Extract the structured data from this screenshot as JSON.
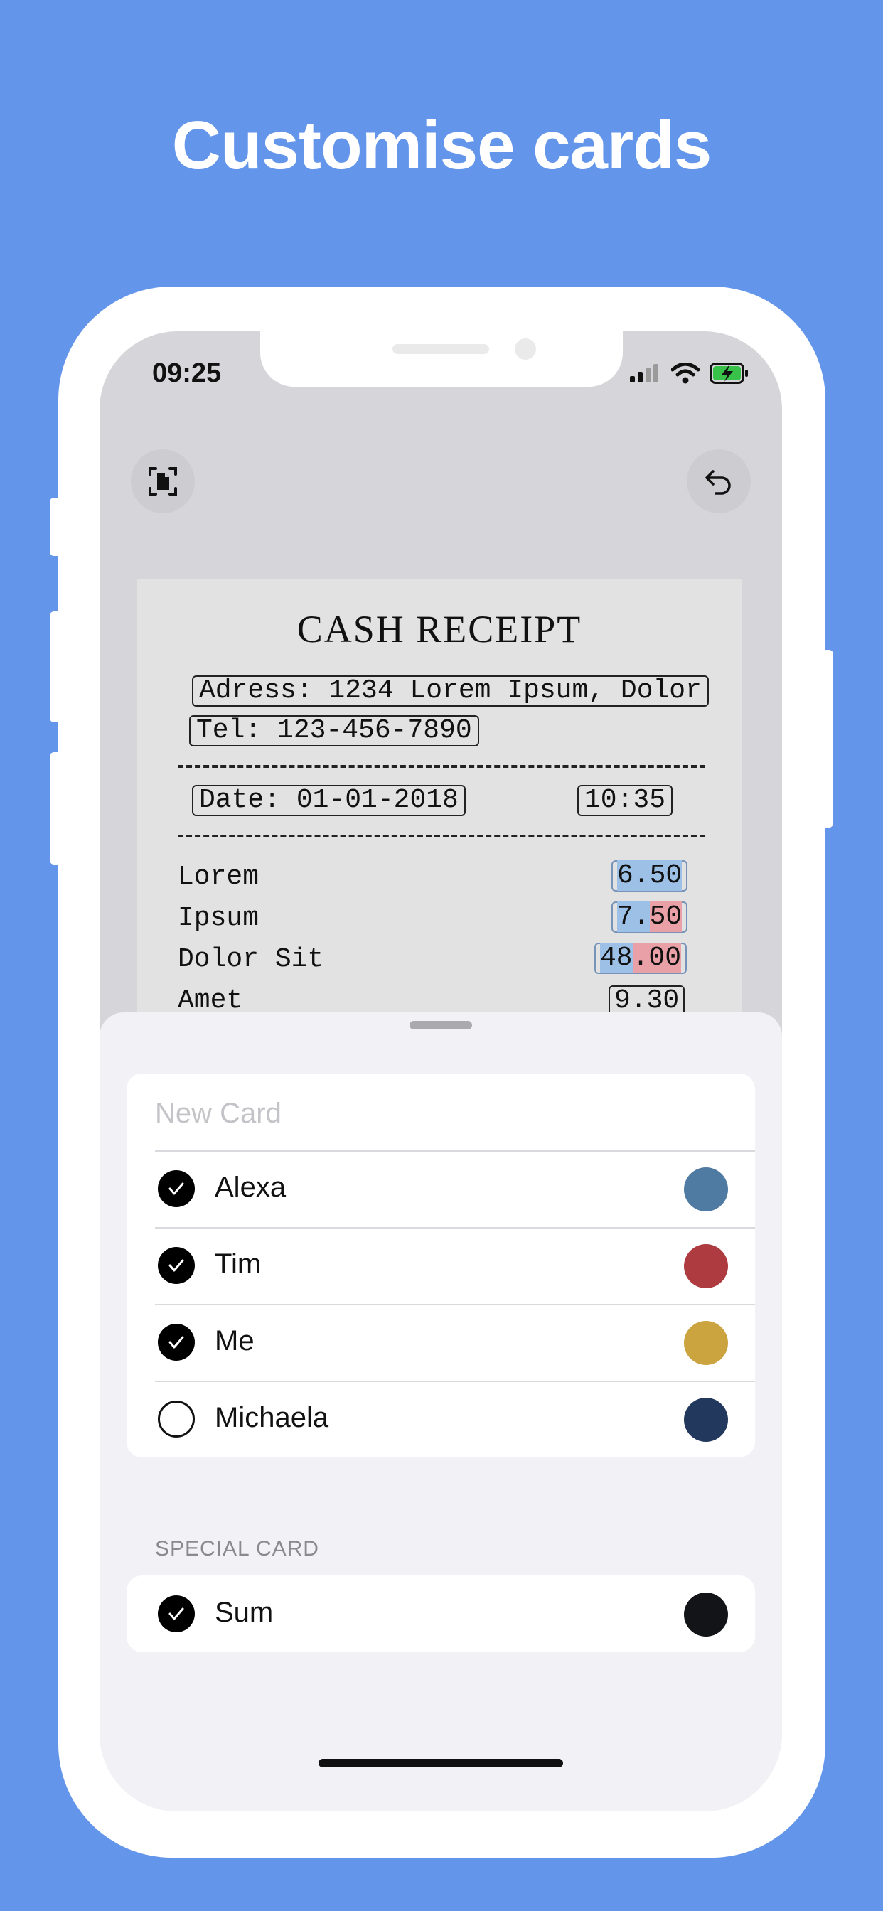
{
  "headline": "Customise cards",
  "status_bar": {
    "time": "09:25"
  },
  "toolbar": {
    "scan_icon": "document-scan-icon",
    "undo_icon": "undo-icon"
  },
  "receipt": {
    "title": "CASH RECEIPT",
    "address": "Adress: 1234 Lorem Ipsum, Dolor",
    "tel": "Tel: 123-456-7890",
    "date": "Date: 01-01-2018",
    "time": "10:35",
    "items": [
      {
        "name": "Lorem",
        "price_a": "6.50",
        "price_b": ""
      },
      {
        "name": "Ipsum",
        "price_a": "7.",
        "price_b": "50"
      },
      {
        "name": "Dolor Sit",
        "price_a": "48",
        "price_b": ".00"
      },
      {
        "name": "Amet",
        "price_a": "9.30",
        "price_b": ""
      }
    ]
  },
  "cards": {
    "new_card_placeholder": "New Card",
    "items": [
      {
        "label": "Alexa",
        "checked": true,
        "color": "#4f7ba3"
      },
      {
        "label": "Tim",
        "checked": true,
        "color": "#ae3b3f"
      },
      {
        "label": "Me",
        "checked": true,
        "color": "#cba440"
      },
      {
        "label": "Michaela",
        "checked": false,
        "color": "#22385c"
      }
    ]
  },
  "special": {
    "header": "SPECIAL CARD",
    "items": [
      {
        "label": "Sum",
        "checked": true,
        "color": "#131417"
      }
    ]
  }
}
